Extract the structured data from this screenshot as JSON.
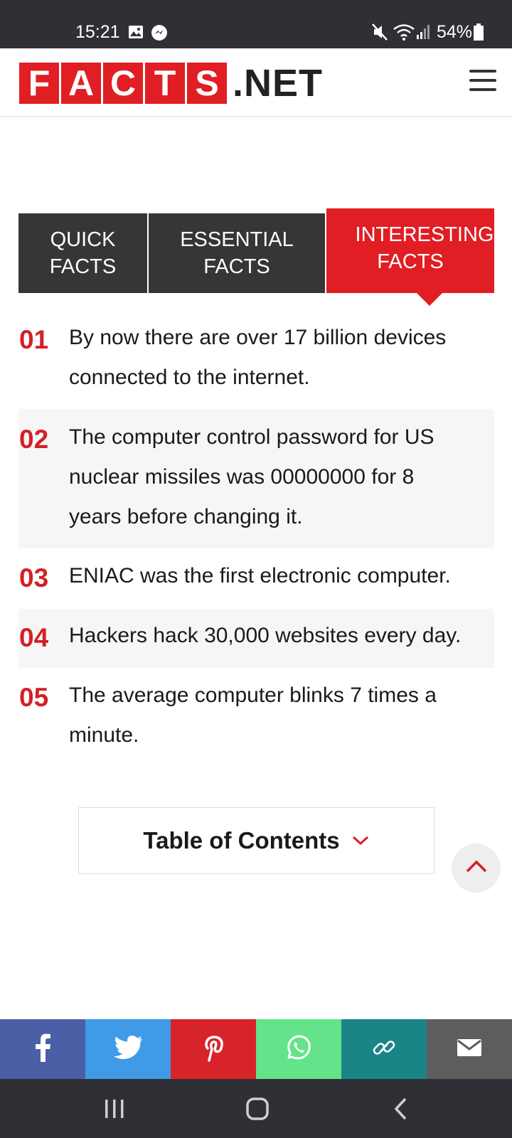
{
  "status_bar": {
    "time": "15:21",
    "battery": "54%",
    "icons": [
      "gallery-icon",
      "messenger-icon",
      "mute-icon",
      "wifi-icon",
      "signal-icon",
      "battery-icon"
    ]
  },
  "header": {
    "logo_letters": [
      "F",
      "A",
      "C",
      "T",
      "S"
    ],
    "logo_suffix": ".NET",
    "brand_color": "#e01e24",
    "menu_icon": "hamburger-menu-icon"
  },
  "tabs": [
    {
      "line1": "QUICK",
      "line2": "FACTS",
      "active": false
    },
    {
      "line1": "ESSENTIAL",
      "line2": "FACTS",
      "active": false
    },
    {
      "line1": "INTERESTING",
      "line2": "FACTS",
      "active": true
    }
  ],
  "facts": [
    {
      "num": "01",
      "lines": [
        "By now there are over 17 billion devices",
        "connected to the internet."
      ]
    },
    {
      "num": "02",
      "lines": [
        "The computer control password for US",
        "nuclear missiles was 00000000 for 8",
        "years before changing it."
      ]
    },
    {
      "num": "03",
      "lines": [
        "ENIAC was the first electronic computer."
      ]
    },
    {
      "num": "04",
      "lines": [
        "Hackers hack 30,000 websites every day."
      ]
    },
    {
      "num": "05",
      "lines": [
        "The average computer blinks 7 times a",
        "minute."
      ]
    }
  ],
  "toc": {
    "label": "Table of Contents",
    "icon": "chevron-down-icon"
  },
  "scroll_top": {
    "icon": "chevron-up-icon"
  },
  "share": [
    {
      "name": "facebook",
      "icon": "facebook-icon",
      "color": "#4a5fa6"
    },
    {
      "name": "twitter",
      "icon": "twitter-icon",
      "color": "#3f9ae8"
    },
    {
      "name": "pinterest",
      "icon": "pinterest-icon",
      "color": "#d7242a"
    },
    {
      "name": "whatsapp",
      "icon": "whatsapp-icon",
      "color": "#64e38a"
    },
    {
      "name": "copy-link",
      "icon": "link-icon",
      "color": "#1b8487"
    },
    {
      "name": "email",
      "icon": "mail-icon",
      "color": "#5d5d5d"
    }
  ],
  "nav_bar": {
    "icons": [
      "recent-apps-icon",
      "home-icon",
      "back-icon"
    ]
  }
}
